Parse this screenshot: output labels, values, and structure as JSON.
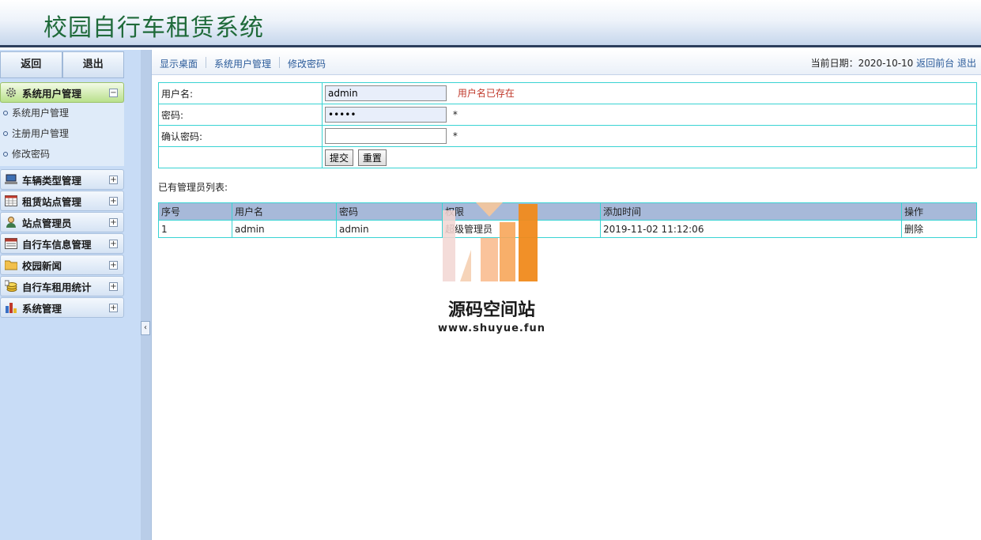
{
  "header": {
    "title": "校园自行车租赁系统"
  },
  "sidebar": {
    "back_label": "返回",
    "logout_label": "退出",
    "groups": [
      {
        "label": "系统用户管理",
        "icon": "gear-icon",
        "toggle": "−"
      },
      {
        "label": "车辆类型管理",
        "icon": "laptop-icon",
        "toggle": "+"
      },
      {
        "label": "租赁站点管理",
        "icon": "calendar-icon",
        "toggle": "+"
      },
      {
        "label": "站点管理员",
        "icon": "user-icon",
        "toggle": "+"
      },
      {
        "label": "自行车信息管理",
        "icon": "calendar-red-icon",
        "toggle": "+"
      },
      {
        "label": "校园新闻",
        "icon": "folder-icon",
        "toggle": "+"
      },
      {
        "label": "自行车租用统计",
        "icon": "coins-icon",
        "toggle": "+"
      },
      {
        "label": "系统管理",
        "icon": "bar-chart-icon",
        "toggle": "+"
      }
    ],
    "subitems": [
      "系统用户管理",
      "注册用户管理",
      "修改密码"
    ],
    "collapse_glyph": "‹"
  },
  "topnav": {
    "crumbs": [
      "显示桌面",
      "系统用户管理",
      "修改密码"
    ],
    "date_label": "当前日期：2020-10-10",
    "home_link": "返回前台",
    "logout_link": "退出"
  },
  "form": {
    "username_label": "用户名:",
    "username_value": "admin",
    "username_error": "用户名已存在",
    "password_label": "密码:",
    "password_value": "•••••",
    "password_star": "*",
    "confirm_label": "确认密码:",
    "confirm_value": "",
    "confirm_star": "*",
    "submit_label": "提交",
    "reset_label": "重置"
  },
  "list": {
    "title": "已有管理员列表:",
    "headers": [
      "序号",
      "用户名",
      "密码",
      "权限",
      "添加时间",
      "操作"
    ],
    "rows": [
      {
        "id": "1",
        "username": "admin",
        "password": "admin",
        "role": "超级管理员",
        "time": "2019-11-02 11:12:06",
        "action": "删除"
      }
    ]
  },
  "watermark": {
    "name": "源码空间站",
    "url": "www.shuyue.fun"
  }
}
